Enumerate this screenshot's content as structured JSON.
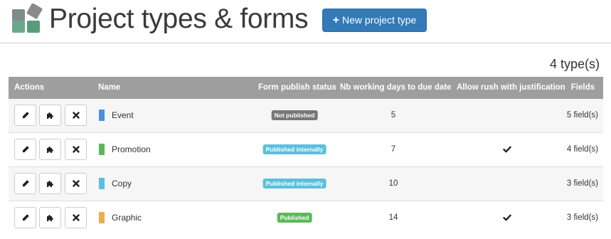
{
  "header": {
    "title": "Project types & forms",
    "new_button_icon": "plus-icon",
    "new_button_label": "New project type"
  },
  "count": {
    "value": "4",
    "unit": "type(s)"
  },
  "table": {
    "columns": {
      "actions": "Actions",
      "name": "Name",
      "publish_status": "Form publish status",
      "days": "Nb working days to due date",
      "rush": "Allow rush with justification",
      "fields": "Fields"
    },
    "rows": [
      {
        "name": "Event",
        "color": "#4a90d9",
        "status": "Not published",
        "status_color": "#777777",
        "days": "5",
        "rush": false,
        "fields": "5 field(s)"
      },
      {
        "name": "Promotion",
        "color": "#5cb85c",
        "status": "Published internally",
        "status_color": "#5bc0de",
        "days": "7",
        "rush": true,
        "fields": "4 field(s)"
      },
      {
        "name": "Copy",
        "color": "#5bc0de",
        "status": "Published internally",
        "status_color": "#5bc0de",
        "days": "10",
        "rush": false,
        "fields": "3 field(s)"
      },
      {
        "name": "Graphic",
        "color": "#f0ad4e",
        "status": "Published",
        "status_color": "#5cb85c",
        "days": "14",
        "rush": true,
        "fields": "3 field(s)"
      }
    ],
    "row_actions": [
      "edit-icon",
      "puzzle-icon",
      "delete-icon"
    ]
  },
  "colors": {
    "primary_button": "#337ab7",
    "header_bg": "#9e9e9e",
    "logo": [
      "#7a7a7a",
      "#5a9a7a"
    ]
  }
}
